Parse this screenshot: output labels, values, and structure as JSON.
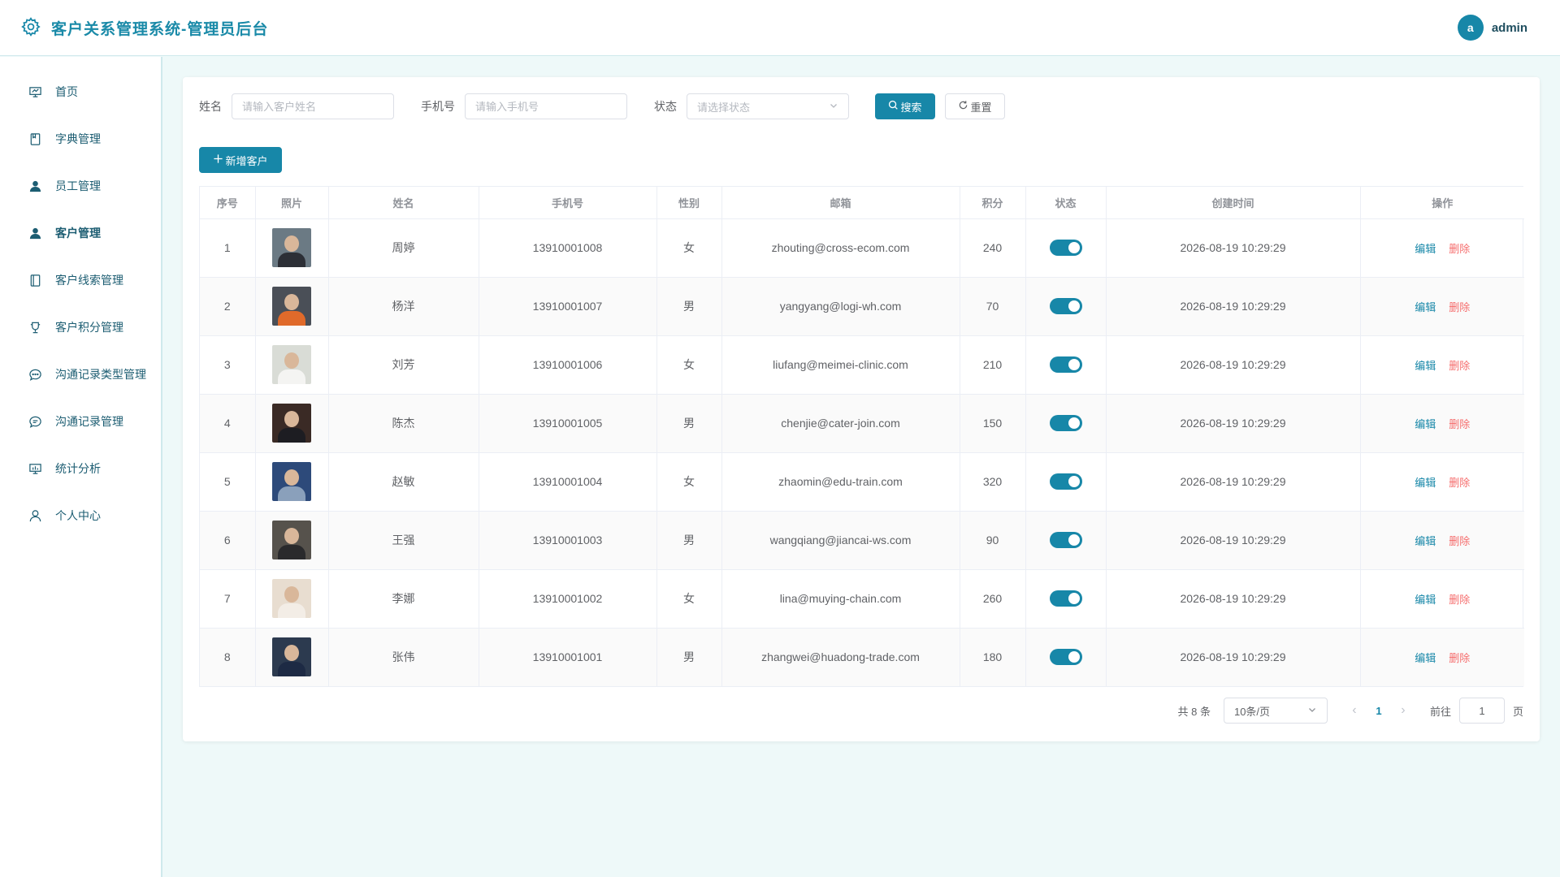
{
  "app": {
    "title": "客户关系管理系统-管理员后台",
    "brand_color": "#1787a8"
  },
  "user": {
    "avatar_letter": "a",
    "name": "admin"
  },
  "sidebar": {
    "items": [
      {
        "label": "首页",
        "icon": "dashboard-icon",
        "active": false
      },
      {
        "label": "字典管理",
        "icon": "book-icon",
        "active": false
      },
      {
        "label": "员工管理",
        "icon": "user-filled-icon",
        "active": false
      },
      {
        "label": "客户管理",
        "icon": "user-filled-icon",
        "active": true
      },
      {
        "label": "客户线索管理",
        "icon": "notebook-icon",
        "active": false
      },
      {
        "label": "客户积分管理",
        "icon": "cup-icon",
        "active": false
      },
      {
        "label": "沟通记录类型管理",
        "icon": "chat-dot-icon",
        "active": false
      },
      {
        "label": "沟通记录管理",
        "icon": "chat-line-icon",
        "active": false
      },
      {
        "label": "统计分析",
        "icon": "chart-board-icon",
        "active": false
      },
      {
        "label": "个人中心",
        "icon": "user-outline-icon",
        "active": false
      }
    ]
  },
  "search": {
    "name_label": "姓名",
    "name_placeholder": "请输入客户姓名",
    "phone_label": "手机号",
    "phone_placeholder": "请输入手机号",
    "status_label": "状态",
    "status_placeholder": "请选择状态",
    "search_button": "搜索",
    "reset_button": "重置"
  },
  "actions": {
    "add_button": "新增客户"
  },
  "table": {
    "headers": [
      "序号",
      "照片",
      "姓名",
      "手机号",
      "性别",
      "邮箱",
      "积分",
      "状态",
      "创建时间",
      "操作"
    ],
    "edit_label": "编辑",
    "delete_label": "删除",
    "rows": [
      {
        "index": "1",
        "name": "周婷",
        "phone": "13910001008",
        "gender": "女",
        "email": "zhouting@cross-ecom.com",
        "points": "240",
        "status": true,
        "created": "2026-08-19 10:29:29"
      },
      {
        "index": "2",
        "name": "杨洋",
        "phone": "13910001007",
        "gender": "男",
        "email": "yangyang@logi-wh.com",
        "points": "70",
        "status": true,
        "created": "2026-08-19 10:29:29"
      },
      {
        "index": "3",
        "name": "刘芳",
        "phone": "13910001006",
        "gender": "女",
        "email": "liufang@meimei-clinic.com",
        "points": "210",
        "status": true,
        "created": "2026-08-19 10:29:29"
      },
      {
        "index": "4",
        "name": "陈杰",
        "phone": "13910001005",
        "gender": "男",
        "email": "chenjie@cater-join.com",
        "points": "150",
        "status": true,
        "created": "2026-08-19 10:29:29"
      },
      {
        "index": "5",
        "name": "赵敏",
        "phone": "13910001004",
        "gender": "女",
        "email": "zhaomin@edu-train.com",
        "points": "320",
        "status": true,
        "created": "2026-08-19 10:29:29"
      },
      {
        "index": "6",
        "name": "王强",
        "phone": "13910001003",
        "gender": "男",
        "email": "wangqiang@jiancai-ws.com",
        "points": "90",
        "status": true,
        "created": "2026-08-19 10:29:29"
      },
      {
        "index": "7",
        "name": "李娜",
        "phone": "13910001002",
        "gender": "女",
        "email": "lina@muying-chain.com",
        "points": "260",
        "status": true,
        "created": "2026-08-19 10:29:29"
      },
      {
        "index": "8",
        "name": "张伟",
        "phone": "13910001001",
        "gender": "男",
        "email": "zhangwei@huadong-trade.com",
        "points": "180",
        "status": true,
        "created": "2026-08-19 10:29:29"
      }
    ]
  },
  "pagination": {
    "total_text": "共 8 条",
    "page_size": "10条/页",
    "current_page": "1",
    "goto_label": "前往",
    "goto_value": "1",
    "page_suffix": "页",
    "prev_icon": "chevron-left-icon",
    "next_icon": "chevron-right-icon"
  },
  "photo_palette": [
    {
      "bg": "#6b7a84",
      "body": "#2c2f36"
    },
    {
      "bg": "#4a4f57",
      "body": "#e06a2a"
    },
    {
      "bg": "#d9dcd6",
      "body": "#f4f4f2"
    },
    {
      "bg": "#3a2a25",
      "body": "#1d1d22"
    },
    {
      "bg": "#2d4a7a",
      "body": "#8aa0bb"
    },
    {
      "bg": "#56524c",
      "body": "#2a2a2c"
    },
    {
      "bg": "#e8ddd0",
      "body": "#f3ede6"
    },
    {
      "bg": "#2c3a4f",
      "body": "#1d2a44"
    }
  ]
}
